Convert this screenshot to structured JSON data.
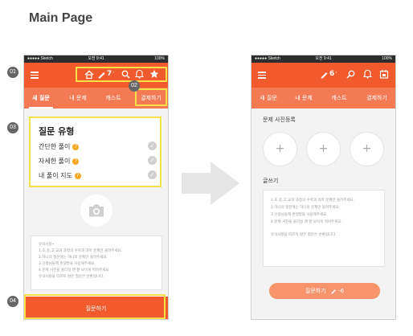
{
  "page_title": "Main Page",
  "markers": {
    "m01": "01",
    "m02": "02",
    "m03": "03",
    "m04": "04"
  },
  "status_bar": {
    "carrier": "●●●●● Sketch",
    "time": "오전 9:41",
    "battery": "100%"
  },
  "left_phone": {
    "appbar": {
      "pencil_count": "7",
      "pencil_suffix": "·"
    },
    "tabs": [
      "새 질문",
      "내 문제",
      "캐스트",
      "결제하기"
    ],
    "question_type": {
      "title": "질문 유형",
      "options": [
        "간단한 풀이",
        "자세한 풀이",
        "내 풀이 지도"
      ]
    },
    "guide_lines": [
      "유의사항•",
      "1.초,중,고 교과 과정의 수학과 과학 문제만 올려주세요.",
      "2.하나의 질문에는 하나의 문제만 올려주세요.",
      "3.선생님들께 존댓말을 사용해주세요.",
      "4.문제 사진을 올리실 땐 잘 보이게 찍어주세요.",
      "유의사항을 따르지 않은 질문은 반환됩니다."
    ],
    "submit_label": "질문하기"
  },
  "right_phone": {
    "appbar": {
      "pencil_count": "6",
      "pencil_suffix": "·"
    },
    "tabs": [
      "새 질문",
      "내 문제",
      "캐스트",
      "결제하기"
    ],
    "photo_label": "문제 사진등록",
    "write_label": "글쓰기",
    "guide_lines": [
      "1.초,중,고 교과 과정의 수학과 과학 문제만 올려주세요.",
      "2.하나의 질문에는 하나의 문제만 올려주세요.",
      "3.선생님들께 존댓말을 사용해주세요.",
      "4.문제 사진을 올리실 땐 잘 보이게 찍어주세요.",
      "유의사항을 따르지 않은 질문은 반환됩니다."
    ],
    "submit_label": "질문하기",
    "submit_cost": "-6"
  },
  "icons": {
    "menu": "hamburger-icon",
    "home": "home-icon",
    "pencil": "pencil-icon",
    "search": "search-icon",
    "bell": "bell-icon",
    "star": "star-icon",
    "calendar": "calendar-icon",
    "camera": "camera-icon",
    "help": "question-icon",
    "check": "check-icon",
    "add": "plus-icon",
    "arrow": "right-arrow-icon"
  },
  "colors": {
    "primary": "#f05a2d",
    "tab_bar": "#f37a52",
    "highlight": "#f6e14b",
    "help": "#f7a620"
  }
}
